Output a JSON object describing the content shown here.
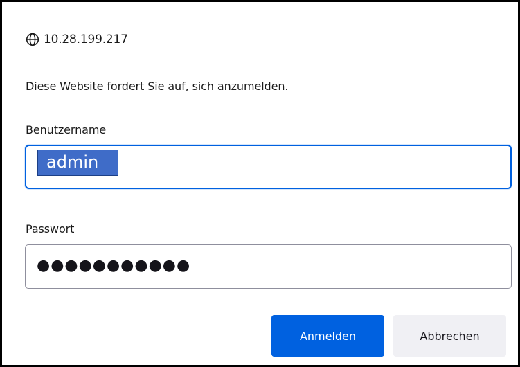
{
  "dialog": {
    "host": "10.28.199.217",
    "host_icon": "globe-icon",
    "message": "Diese Website fordert Sie auf, sich anzumelden.",
    "username": {
      "label": "Benutzername",
      "value": "admin"
    },
    "password": {
      "label": "Passwort",
      "masked_value": "●●●●●●●●●●●"
    },
    "buttons": {
      "login": "Anmelden",
      "cancel": "Abbrechen"
    }
  },
  "colors": {
    "primary": "#0061e0",
    "selection": "#3f6cc8",
    "secondary_button": "#f0f0f4",
    "border": "#000000"
  }
}
